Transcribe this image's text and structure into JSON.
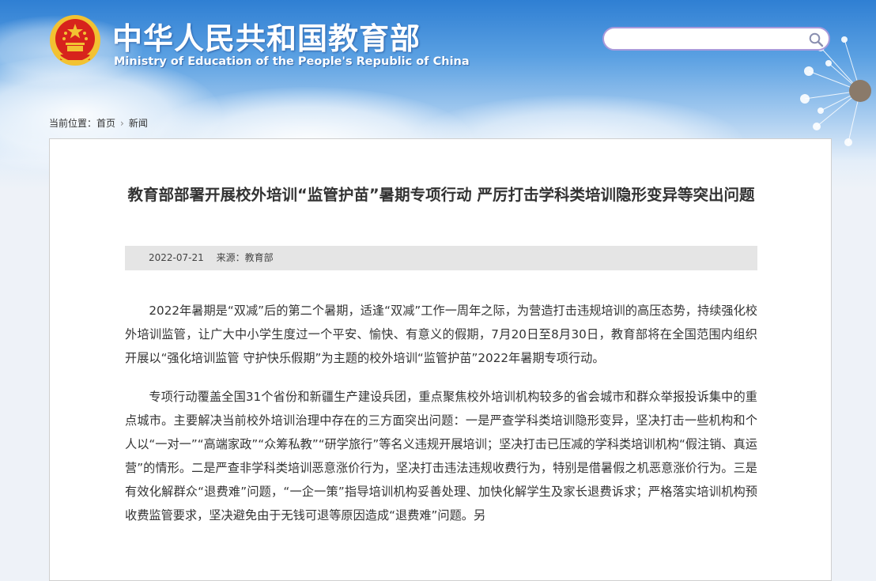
{
  "header": {
    "title": "中华人民共和国教育部",
    "subtitle": "Ministry of Education of the People's Republic of China",
    "search": {
      "placeholder": "",
      "value": ""
    }
  },
  "breadcrumb": {
    "prefix": "当前位置：",
    "items": [
      "首页",
      "新闻"
    ]
  },
  "article": {
    "title": "教育部部署开展校外培训“监管护苗”暑期专项行动 严厉打击学科类培训隐形变异等突出问题",
    "date": "2022-07-21",
    "source": "来源：教育部",
    "paragraphs": [
      "2022年暑期是“双减”后的第二个暑期，适逢“双减”工作一周年之际，为营造打击违规培训的高压态势，持续强化校外培训监管，让广大中小学生度过一个平安、愉快、有意义的假期，7月20日至8月30日，教育部将在全国范围内组织开展以“强化培训监管 守护快乐假期”为主题的校外培训“监管护苗”2022年暑期专项行动。",
      "专项行动覆盖全国31个省份和新疆生产建设兵团，重点聚焦校外培训机构较多的省会城市和群众举报投诉集中的重点城市。主要解决当前校外培训治理中存在的三方面突出问题：一是严查学科类培训隐形变异，坚决打击一些机构和个人以“一对一”“高端家政”“众筹私教”“研学旅行”等名义违规开展培训；坚决打击已压减的学科类培训机构“假注销、真运营”的情形。二是严查非学科类培训恶意涨价行为，坚决打击违法违规收费行为，特别是借暑假之机恶意涨价行为。三是有效化解群众“退费难”问题，“一企一策”指导培训机构妥善处理、加快化解学生及家长退费诉求；严格落实培训机构预收费监管要求，坚决避免由于无钱可退等原因造成“退费难”问题。另"
    ]
  },
  "colors": {
    "emblem_red": "#d7231c",
    "emblem_gold": "#f2c232",
    "search_border": "#a99adb",
    "meta_bg": "#e5e5e5"
  }
}
